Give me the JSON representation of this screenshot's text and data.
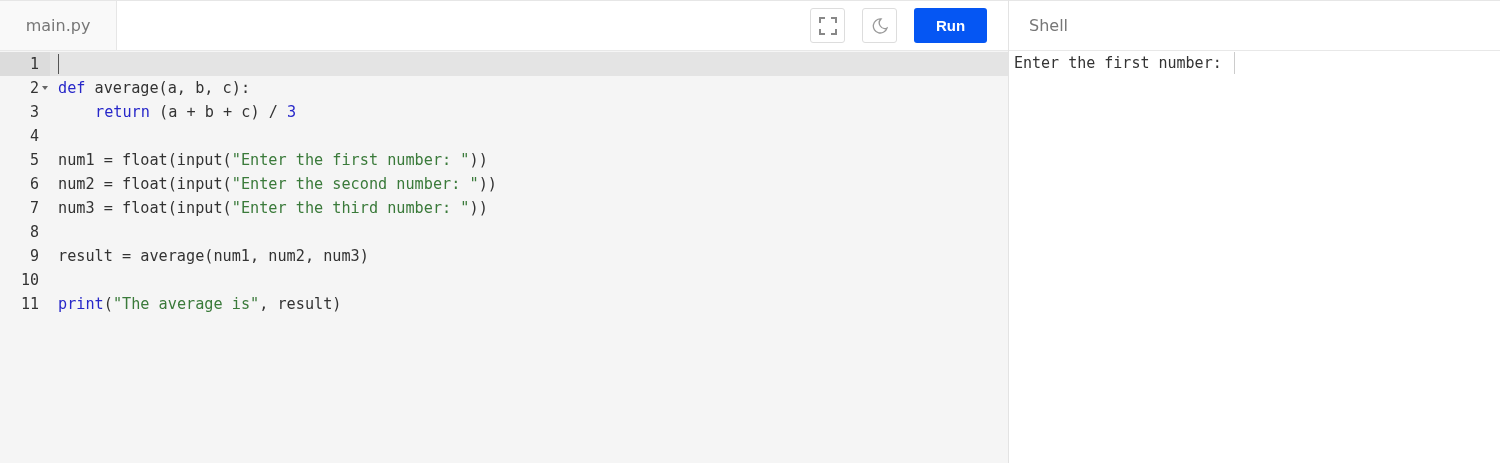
{
  "editor": {
    "tab": {
      "label": "main.py"
    },
    "toolbar": {
      "run_label": "Run"
    },
    "lines": [
      {
        "number": "1",
        "selected": true,
        "foldable": false,
        "indented": false
      },
      {
        "number": "2",
        "selected": false,
        "foldable": true,
        "indented": false,
        "tokens": [
          {
            "kind": "keyword",
            "text": "def"
          },
          {
            "kind": "plain",
            "text": " average(a, b, c):"
          }
        ]
      },
      {
        "number": "3",
        "selected": false,
        "foldable": false,
        "indented": true,
        "tokens": [
          {
            "kind": "keyword",
            "text": "return"
          },
          {
            "kind": "plain",
            "text": " (a + b + c) / "
          },
          {
            "kind": "number",
            "text": "3"
          }
        ]
      },
      {
        "number": "4",
        "selected": false,
        "foldable": false
      },
      {
        "number": "5",
        "selected": false,
        "foldable": false,
        "indented": false,
        "tokens": [
          {
            "kind": "plain",
            "text": "num1 = float(input("
          },
          {
            "kind": "string",
            "text": "\"Enter the first number: \""
          },
          {
            "kind": "plain",
            "text": "))"
          }
        ]
      },
      {
        "number": "6",
        "selected": false,
        "foldable": false,
        "indented": false,
        "tokens": [
          {
            "kind": "plain",
            "text": "num2 = float(input("
          },
          {
            "kind": "string",
            "text": "\"Enter the second number: \""
          },
          {
            "kind": "plain",
            "text": "))"
          }
        ]
      },
      {
        "number": "7",
        "selected": false,
        "foldable": false,
        "indented": false,
        "tokens": [
          {
            "kind": "plain",
            "text": "num3 = float(input("
          },
          {
            "kind": "string",
            "text": "\"Enter the third number: \""
          },
          {
            "kind": "plain",
            "text": "))"
          }
        ]
      },
      {
        "number": "8",
        "selected": false,
        "foldable": false
      },
      {
        "number": "9",
        "selected": false,
        "foldable": false,
        "indented": false,
        "tokens": [
          {
            "kind": "plain",
            "text": "result = average(num1, num2, num3)"
          }
        ]
      },
      {
        "number": "10",
        "selected": false,
        "foldable": false
      },
      {
        "number": "11",
        "selected": false,
        "foldable": false,
        "indented": false,
        "tokens": [
          {
            "kind": "keyword",
            "text": "print"
          },
          {
            "kind": "plain",
            "text": "("
          },
          {
            "kind": "string",
            "text": "\"The average is\""
          },
          {
            "kind": "plain",
            "text": ", result)"
          }
        ]
      }
    ]
  },
  "shell": {
    "title": "Shell",
    "output": "Enter the first number:"
  }
}
